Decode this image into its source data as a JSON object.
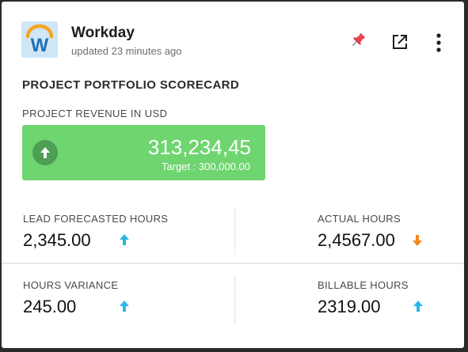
{
  "header": {
    "app_name": "Workday",
    "updated": "updated 23 minutes ago",
    "logo_letter": "W",
    "icons": [
      "pin-icon",
      "open-external-icon",
      "more-vertical-icon"
    ]
  },
  "scorecard": {
    "title": "PROJECT PORTFOLIO SCORECARD",
    "revenue_label": "PROJECT REVENUE IN USD",
    "revenue_value": "313,234,45",
    "revenue_target": "Target : 300,000.00",
    "revenue_trend": "up"
  },
  "metrics": [
    {
      "label": "LEAD FORECASTED HOURS",
      "value": "2,345.00",
      "trend": "up"
    },
    {
      "label": "ACTUAL HOURS",
      "value": "2,4567.00",
      "trend": "down"
    },
    {
      "label": "HOURS VARIANCE",
      "value": "245.00",
      "trend": "up"
    },
    {
      "label": "BILLABLE HOURS",
      "value": "2319.00",
      "trend": "up"
    }
  ],
  "colors": {
    "kpi_green": "#6fd570",
    "kpi_circle": "#4e9e54",
    "up_arrow": "#29b6e8",
    "down_arrow": "#f5871f",
    "pin": "#e8434f",
    "logo_bg": "#cfe6f7",
    "logo_letter": "#1f6fb5"
  }
}
